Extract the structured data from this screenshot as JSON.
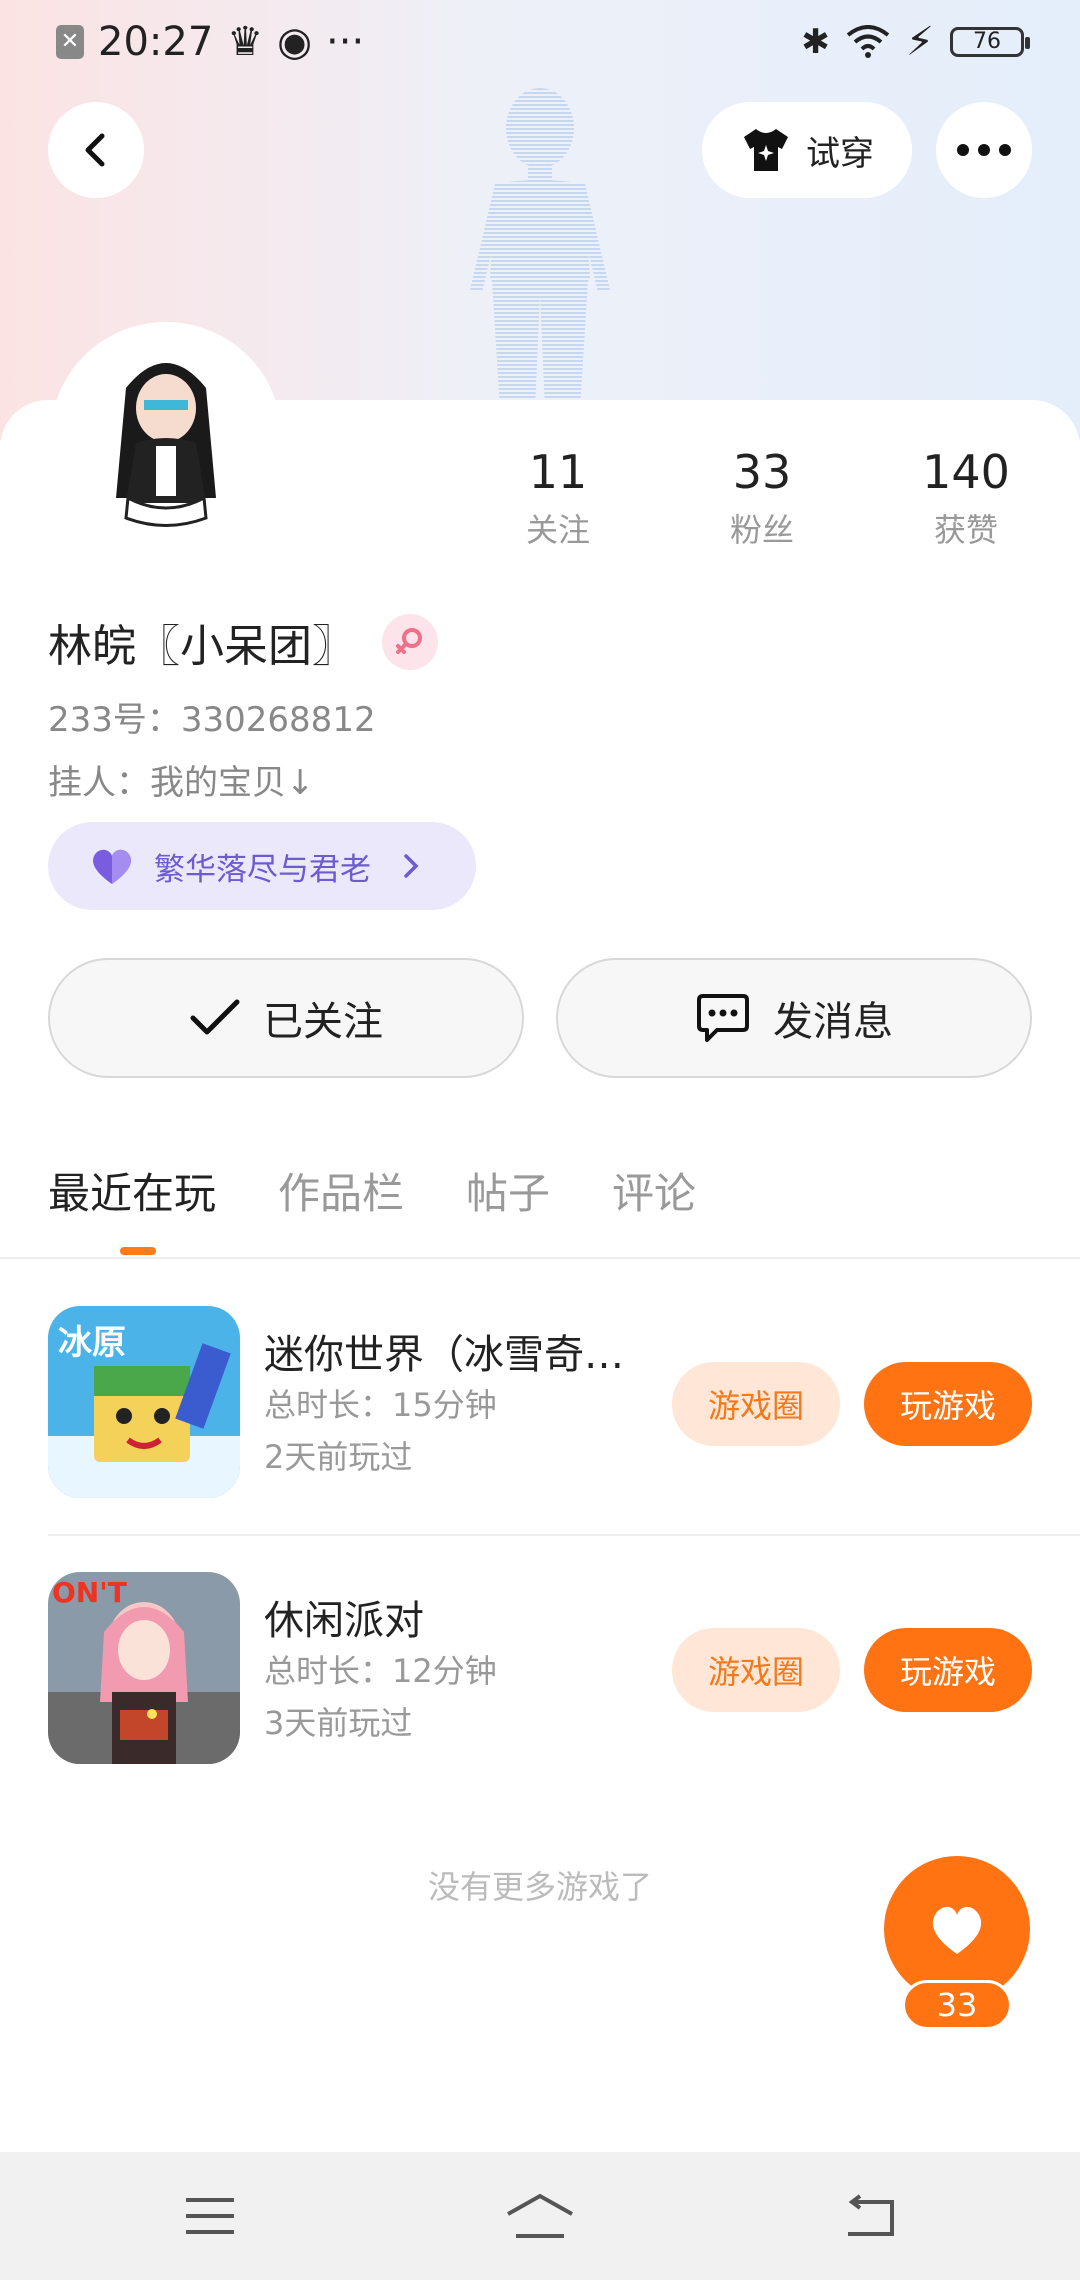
{
  "status_bar": {
    "time": "20:27",
    "battery": "76",
    "more": "···"
  },
  "header": {
    "tryon_label": "试穿"
  },
  "profile": {
    "stats": [
      {
        "value": "11",
        "label": "关注"
      },
      {
        "value": "33",
        "label": "粉丝"
      },
      {
        "value": "140",
        "label": "获赞"
      }
    ],
    "nickname": "林皖〖小呆团〗",
    "uid": "233号：330268812",
    "bio": "挂人：我的宝贝↓",
    "cp_tag": "繁华落尽与君老",
    "follow_label": "已关注",
    "message_label": "发消息"
  },
  "tabs": [
    {
      "label": "最近在玩",
      "active": true
    },
    {
      "label": "作品栏",
      "active": false
    },
    {
      "label": "帖子",
      "active": false
    },
    {
      "label": "评论",
      "active": false
    }
  ],
  "games": [
    {
      "name": "迷你世界（冰雪奇…",
      "duration": "总时长：15分钟",
      "last_played": "2天前玩过",
      "icon_text": "冰原",
      "circle_label": "游戏圈",
      "play_label": "玩游戏"
    },
    {
      "name": "休闲派对",
      "duration": "总时长：12分钟",
      "last_played": "3天前玩过",
      "icon_text": "ON'T",
      "circle_label": "游戏圈",
      "play_label": "玩游戏"
    }
  ],
  "footer": {
    "no_more": "没有更多游戏了",
    "like_count": "33"
  },
  "colors": {
    "accent": "#ff7312",
    "accent_light": "#ffe6d6",
    "cp_bg": "#ebe8fb",
    "cp_text": "#6d5bd0"
  },
  "icons": [
    "back-arrow-icon",
    "tshirt-icon",
    "more-dots-icon",
    "female-icon",
    "heart-icon",
    "check-icon",
    "chat-bubble-icon",
    "menu-icon",
    "home-icon",
    "back-nav-icon"
  ]
}
